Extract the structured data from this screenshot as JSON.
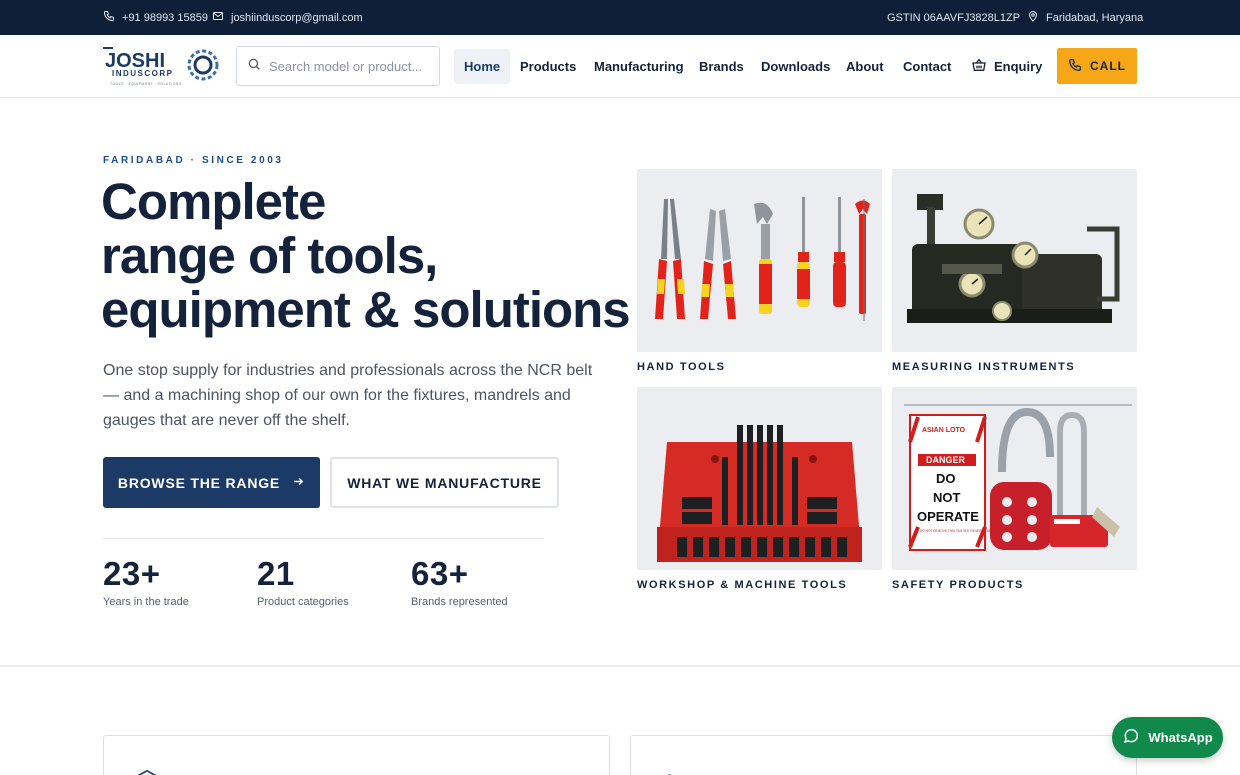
{
  "topbar": {
    "phone": "+91 98993 15859",
    "email": "joshiinduscorp@gmail.com",
    "gstin": "GSTIN 06AAVFJ3828L1ZP",
    "location": "Faridabad, Haryana"
  },
  "brand": {
    "logo_word": "JOSHI",
    "logo_sub": "INDUSCORP",
    "logo_tagline": "TOOLS · EQUIPMENT · SOLUTIONS"
  },
  "search": {
    "placeholder": "Search model or product..."
  },
  "nav": {
    "home": "Home",
    "products": "Products",
    "manufacturing": "Manufacturing",
    "brands": "Brands",
    "downloads": "Downloads",
    "about": "About",
    "contact": "Contact",
    "enquiry": "Enquiry",
    "call": "CALL"
  },
  "hero": {
    "eyebrow": "FARIDABAD · SINCE 2003",
    "headline": [
      "Complete",
      "range of tools,",
      "equipment & solutions"
    ],
    "lede": "One stop supply for industries and professionals across the NCR belt — and a machining shop of our own for the fixtures, mandrels and gauges that are never off the shelf.",
    "primary_button": "BROWSE THE RANGE",
    "secondary_button": "WHAT WE MANUFACTURE"
  },
  "stats": [
    {
      "value": "23+",
      "label": "Years in the trade"
    },
    {
      "value": "21",
      "label": "Product categories"
    },
    {
      "value": "63+",
      "label": "Brands represented"
    }
  ],
  "categories": [
    {
      "label": "HAND TOOLS",
      "image": "insulated-hand-tools"
    },
    {
      "label": "MEASURING INSTRUMENTS",
      "image": "dial-gauge-fixture"
    },
    {
      "label": "WORKSHOP & MACHINE TOOLS",
      "image": "clamping-kit-tray"
    },
    {
      "label": "SAFETY PRODUCTS",
      "image": "lockout-tagout-kit"
    }
  ],
  "safety_tag": {
    "brand": "ASIAN LOTO",
    "danger": "DANGER",
    "lines": [
      "DO",
      "NOT",
      "OPERATE"
    ],
    "footer": "DO NOT REMOVE THIS TAG SEE REVERSE SIDE"
  },
  "whatsapp": {
    "label": "WhatsApp"
  },
  "colors": {
    "navy": "#14233b",
    "accent": "#f5a718",
    "topbar": "#0f1f38",
    "whatsapp": "#0f8a4a"
  },
  "icons": [
    "phone-icon",
    "mail-icon",
    "location-pin-icon",
    "search-icon",
    "basket-icon",
    "arrow-right-icon",
    "whatsapp-icon"
  ]
}
